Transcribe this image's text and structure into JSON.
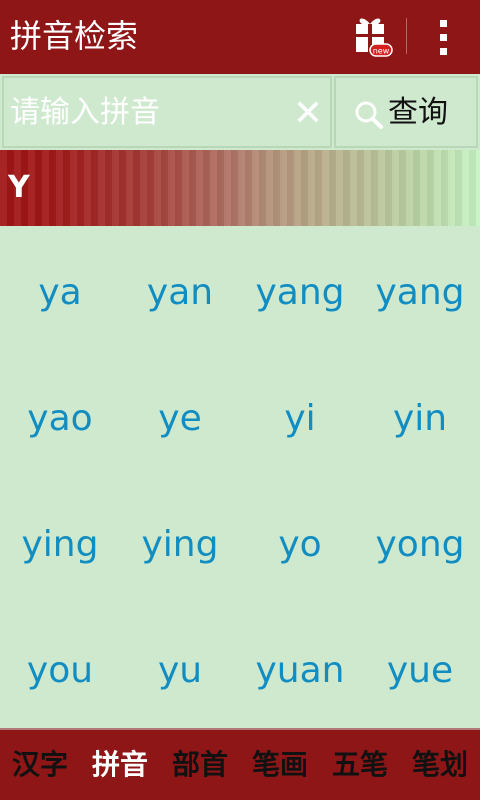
{
  "appbar": {
    "title": "拼音检索",
    "gift_badge": "new"
  },
  "search": {
    "placeholder": "请输入拼音",
    "value": "",
    "clear_symbol": "✕",
    "query_label": "查询"
  },
  "section": {
    "letter": "Y"
  },
  "pinyin": [
    "ya",
    "yan",
    "yang",
    "yang",
    "yao",
    "ye",
    "yi",
    "yin",
    "ying",
    "ying",
    "yo",
    "yong",
    "you",
    "yu",
    "yuan",
    "yue"
  ],
  "tabs": [
    {
      "label": "汉字",
      "active": false
    },
    {
      "label": "拼音",
      "active": true
    },
    {
      "label": "部首",
      "active": false
    },
    {
      "label": "笔画",
      "active": false
    },
    {
      "label": "五笔",
      "active": false
    },
    {
      "label": "笔划",
      "active": false
    }
  ],
  "colors": {
    "appbar": "#8f1616",
    "background": "#cfe9cf",
    "pinyin_text": "#118dc2",
    "active_tab": "#ffffff",
    "inactive_tab": "#111111"
  }
}
